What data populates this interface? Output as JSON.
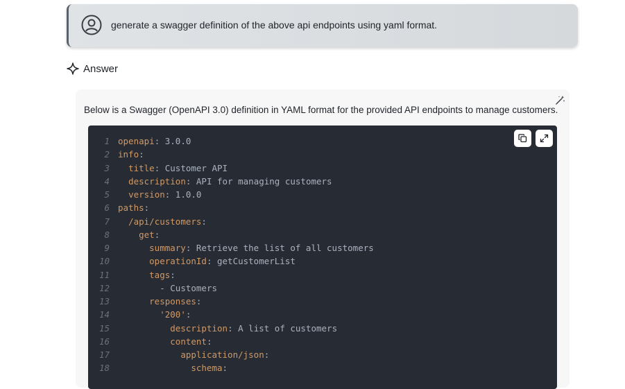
{
  "prompt": {
    "text": "generate a swagger definition of the above api endpoints using yaml format."
  },
  "answer": {
    "header": "Answer",
    "intro": "Below is a Swagger (OpenAPI 3.0) definition in YAML format for the provided API endpoints to manage customers."
  },
  "code": {
    "lines": [
      {
        "n": "1",
        "indent": "",
        "key": "openapi",
        "val": "3.0.0"
      },
      {
        "n": "2",
        "indent": "",
        "key": "info",
        "val": ""
      },
      {
        "n": "3",
        "indent": "  ",
        "key": "title",
        "val": "Customer API"
      },
      {
        "n": "4",
        "indent": "  ",
        "key": "description",
        "val": "API for managing customers"
      },
      {
        "n": "5",
        "indent": "  ",
        "key": "version",
        "val": "1.0.0"
      },
      {
        "n": "6",
        "indent": "",
        "key": "paths",
        "val": ""
      },
      {
        "n": "7",
        "indent": "  ",
        "key": "/api/customers",
        "val": ""
      },
      {
        "n": "8",
        "indent": "    ",
        "key": "get",
        "val": ""
      },
      {
        "n": "9",
        "indent": "      ",
        "key": "summary",
        "val": "Retrieve the list of all customers"
      },
      {
        "n": "10",
        "indent": "      ",
        "key": "operationId",
        "val": "getCustomerList"
      },
      {
        "n": "11",
        "indent": "      ",
        "key": "tags",
        "val": ""
      },
      {
        "n": "12",
        "indent": "        ",
        "key": "",
        "val": "- Customers"
      },
      {
        "n": "13",
        "indent": "      ",
        "key": "responses",
        "val": ""
      },
      {
        "n": "14",
        "indent": "        ",
        "key": "'200'",
        "val": ""
      },
      {
        "n": "15",
        "indent": "          ",
        "key": "description",
        "val": "A list of customers"
      },
      {
        "n": "16",
        "indent": "          ",
        "key": "content",
        "val": ""
      },
      {
        "n": "17",
        "indent": "            ",
        "key": "application/json",
        "val": ""
      },
      {
        "n": "18",
        "indent": "              ",
        "key": "schema",
        "val": ""
      }
    ]
  },
  "icons": {
    "avatar": "user-circle-icon",
    "answer": "sparkle-icon",
    "wand": "magic-wand-icon",
    "copy": "copy-icon",
    "expand": "expand-icon"
  }
}
